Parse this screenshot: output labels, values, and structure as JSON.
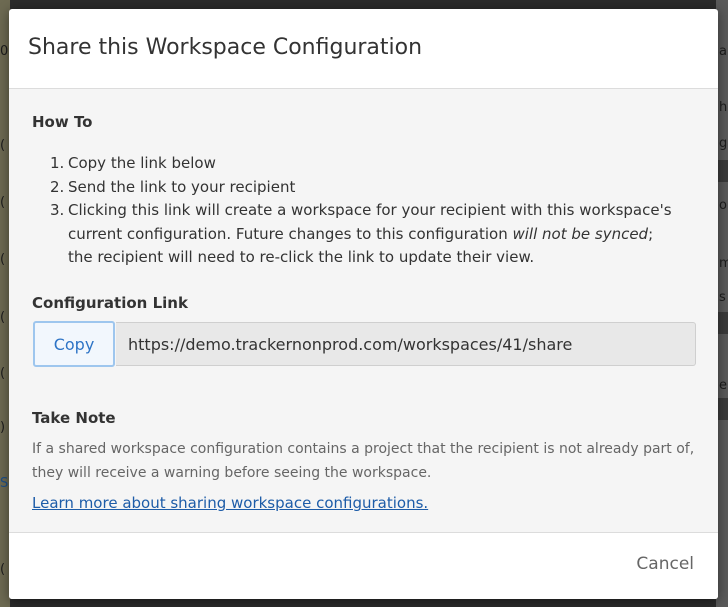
{
  "background": {
    "left_fragments": [
      "0(",
      "(",
      "(",
      "(",
      "(",
      "(",
      "(",
      "(",
      "(",
      ")",
      "S",
      "("
    ],
    "right_fragments": [
      "a",
      "h",
      "g",
      "o",
      "m",
      "s",
      "e"
    ]
  },
  "dialog": {
    "title": "Share this Workspace Configuration",
    "how_to": {
      "heading": "How To",
      "steps": [
        {
          "num": "1.",
          "text": "Copy the link below"
        },
        {
          "num": "2.",
          "text": "Send the link to your recipient"
        },
        {
          "num": "3.",
          "text_before": "Clicking this link will create a workspace for your recipient with this workspace's current configuration. Future changes to this configuration ",
          "emphasis": "will not be synced",
          "text_after": "; the recipient will need to re-click the link to update their view."
        }
      ]
    },
    "config_link": {
      "heading": "Configuration Link",
      "copy_label": "Copy",
      "url": "https://demo.trackernonprod.com/workspaces/41/share"
    },
    "take_note": {
      "heading": "Take Note",
      "text": "If a shared workspace configuration contains a project that the recipient is not already part of, they will receive a warning before seeing the workspace.",
      "link_text": "Learn more about sharing workspace configurations."
    },
    "footer": {
      "cancel_label": "Cancel"
    }
  },
  "colors": {
    "overlay": "#2b2b2b",
    "modal_body": "#f5f5f5",
    "copy_button_border": "#9ec6ee",
    "copy_button_text": "#2e74c6",
    "link": "#1d5ca8"
  }
}
